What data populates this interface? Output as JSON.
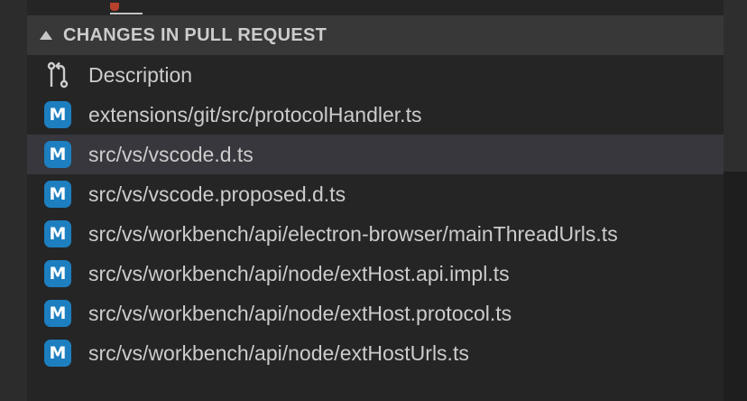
{
  "section": {
    "title": "CHANGES IN PULL REQUEST"
  },
  "items": [
    {
      "label": "Description",
      "icon": "pull-request-icon"
    },
    {
      "label": "extensions/git/src/protocolHandler.ts",
      "badge": "M",
      "icon": "modified-badge-icon"
    },
    {
      "label": "src/vs/vscode.d.ts",
      "badge": "M",
      "icon": "modified-badge-icon",
      "selected": true
    },
    {
      "label": "src/vs/vscode.proposed.d.ts",
      "badge": "M",
      "icon": "modified-badge-icon"
    },
    {
      "label": "src/vs/workbench/api/electron-browser/mainThreadUrls.ts",
      "badge": "M",
      "icon": "modified-badge-icon"
    },
    {
      "label": "src/vs/workbench/api/node/extHost.api.impl.ts",
      "badge": "M",
      "icon": "modified-badge-icon"
    },
    {
      "label": "src/vs/workbench/api/node/extHost.protocol.ts",
      "badge": "M",
      "icon": "modified-badge-icon"
    },
    {
      "label": "src/vs/workbench/api/node/extHostUrls.ts",
      "badge": "M",
      "icon": "modified-badge-icon"
    }
  ],
  "colors": {
    "badge": "#1d7fc0",
    "selected_row": "#37373d",
    "header": "#383838"
  }
}
